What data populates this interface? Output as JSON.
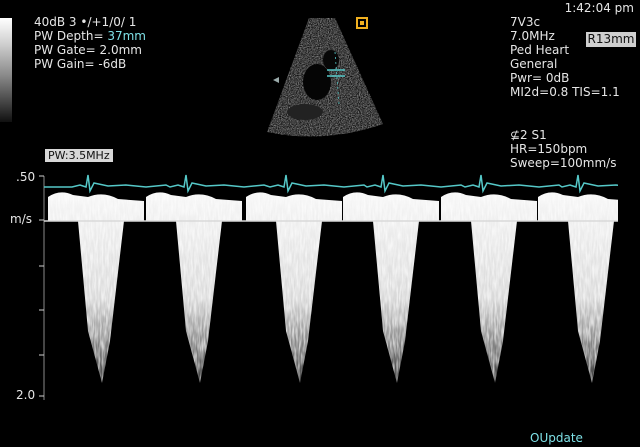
{
  "header": {
    "time": "1:42:04 pm",
    "left_lines": [
      "40dB  3 •/+1/0/ 1",
      "PW Depth= ",
      "PW Gate=  2.0mm",
      "PW Gain=  -6dB"
    ],
    "depth_value": "37mm",
    "probe_lines": [
      "7V3c",
      "7.0MHz",
      "Ped Heart",
      "General",
      "Pwr=    0dB",
      "MI2d=0.8    TIS=1.1"
    ],
    "zoom_box": "R13mm",
    "sweep_lines": [
      "⊈2 S1",
      "HR=150bpm",
      "Sweep=100mm/s"
    ]
  },
  "doppler": {
    "mode_label": "PW:3.5MHz",
    "axis_top": ".50",
    "axis_unit": "m/s",
    "axis_bottom": "2.0"
  },
  "footer": {
    "update_label": "Update",
    "update_prefix": "O"
  },
  "colors": {
    "trace": "#55c8c8",
    "text": "#e6e6e6",
    "accent": "#7ee0e6",
    "orientation_marker": "#f0b020"
  }
}
